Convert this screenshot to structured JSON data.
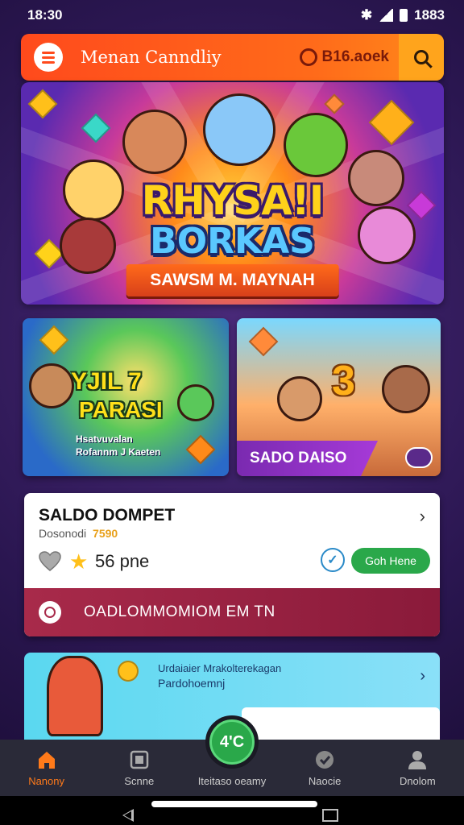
{
  "status_bar": {
    "time": "18:30",
    "battery": "1883"
  },
  "header": {
    "title": "Menan Canndliy",
    "coins": "B16.aoek"
  },
  "hero": {
    "title_line1": "RHYSA!I",
    "title_line2": "BORKAS",
    "ribbon": "SAWSM M. MAYNAH"
  },
  "promos": {
    "left": {
      "title_line1": "YJIL 7",
      "title_line2": "PARASI",
      "sub_line1": "Hsatvuvalan",
      "sub_line2": "Rofannm J Kaeten"
    },
    "right": {
      "number": "3",
      "label": "SADO DAISO"
    }
  },
  "wallet": {
    "title": "SALDO DOMPET",
    "sub_label": "Dosonodi",
    "sub_value": "7590",
    "points": "56 pne",
    "go_label": "Goh Hene",
    "band_text": "OADLOMMOMIOM EM TN"
  },
  "shop": {
    "line1": "Urdaiaier Mrakolterekagan",
    "line2": "Pardohoemnj"
  },
  "bottom_nav": {
    "items": [
      {
        "label": "Nanony",
        "icon": "home-icon",
        "active": true
      },
      {
        "label": "Scnne",
        "icon": "game-icon",
        "active": false
      },
      {
        "label": "Iteitaso oeamy",
        "icon": "wallet-icon",
        "active": false
      },
      {
        "label": "Naocie",
        "icon": "check-shield-icon",
        "active": false
      },
      {
        "label": "Dnolom",
        "icon": "profile-icon",
        "active": false
      }
    ],
    "fab_label": "4'C"
  },
  "colors": {
    "accent": "#ff5a1c",
    "success": "#2aa84a",
    "band": "#a82a4a"
  }
}
